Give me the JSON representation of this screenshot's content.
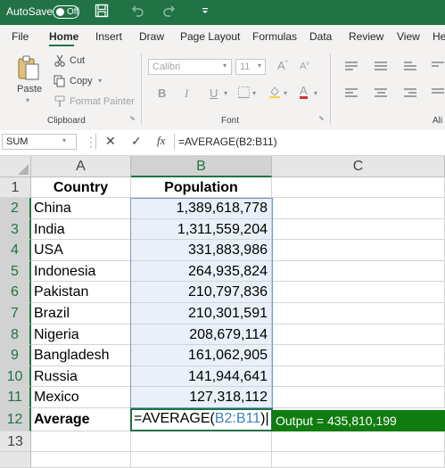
{
  "titlebar": {
    "autosave_label": "AutoSave",
    "toggle_state": "Off",
    "icons": [
      "save-icon",
      "undo-icon",
      "redo-icon",
      "customize-qat-icon"
    ]
  },
  "ribbon": {
    "tabs": [
      "File",
      "Home",
      "Insert",
      "Draw",
      "Page Layout",
      "Formulas",
      "Data",
      "Review",
      "View",
      "He"
    ],
    "active_tab": "Home",
    "clipboard": {
      "paste": "Paste",
      "cut": "Cut",
      "copy": "Copy",
      "format_painter": "Format Painter",
      "group_label": "Clipboard"
    },
    "font": {
      "font_name": "Calibri",
      "font_size": "11",
      "bold": "B",
      "italic": "I",
      "underline": "U",
      "font_color": "A",
      "grow": "A",
      "shrink": "A",
      "group_label": "Font"
    },
    "alignment": {
      "group_label": "Ali"
    }
  },
  "formula_bar": {
    "name_box": "SUM",
    "cancel": "✕",
    "enter": "✓",
    "fx": "fx",
    "formula": "=AVERAGE(B2:B11)"
  },
  "sheet": {
    "column_headers": [
      "A",
      "B",
      "C"
    ],
    "row_numbers": [
      "1",
      "2",
      "3",
      "4",
      "5",
      "6",
      "7",
      "8",
      "9",
      "10",
      "11",
      "12",
      "13"
    ],
    "header_row": {
      "a": "Country",
      "b": "Population"
    },
    "rows": [
      {
        "country": "China",
        "population": "1,389,618,778"
      },
      {
        "country": "India",
        "population": "1,311,559,204"
      },
      {
        "country": "USA",
        "population": "331,883,986"
      },
      {
        "country": "Indonesia",
        "population": "264,935,824"
      },
      {
        "country": "Pakistan",
        "population": "210,797,836"
      },
      {
        "country": "Brazil",
        "population": "210,301,591"
      },
      {
        "country": "Nigeria",
        "population": "208,679,114"
      },
      {
        "country": "Bangladesh",
        "population": "161,062,905"
      },
      {
        "country": "Russia",
        "population": "141,944,641"
      },
      {
        "country": "Mexico",
        "population": "127,318,112"
      }
    ],
    "average_label": "Average",
    "editing_formula": {
      "prefix": "=AVERAGE(",
      "range_ref": "B2:B11",
      "suffix": ")"
    },
    "output_note": "Output = 435,810,199"
  },
  "colors": {
    "excel_green": "#217346",
    "output_green": "#107c10",
    "range_ref_blue": "#3f7fc6"
  }
}
